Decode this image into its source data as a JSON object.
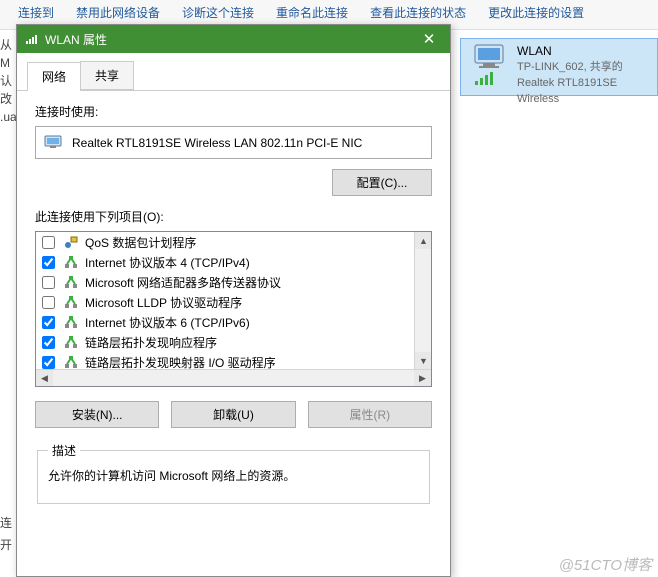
{
  "toolbar": {
    "items": [
      "连接到",
      "禁用此网络设备",
      "诊断这个连接",
      "重命名此连接",
      "查看此连接的状态",
      "更改此连接的设置"
    ]
  },
  "left_strip": "从 M 认 改 .ua",
  "adapter_card": {
    "title": "WLAN",
    "line2": "TP-LINK_602, 共享的",
    "line3": "Realtek RTL8191SE Wireless"
  },
  "dialog": {
    "title": "WLAN 属性",
    "tabs": {
      "t1": "网络",
      "t2": "共享"
    },
    "connect_using_label": "连接时使用:",
    "adapter_name": "Realtek RTL8191SE Wireless LAN 802.11n PCI-E NIC",
    "configure_btn": "配置(C)...",
    "items_label": "此连接使用下列项目(O):",
    "items": [
      {
        "checked": false,
        "icon": "qos",
        "label": "QoS 数据包计划程序"
      },
      {
        "checked": true,
        "icon": "proto",
        "label": "Internet 协议版本 4 (TCP/IPv4)"
      },
      {
        "checked": false,
        "icon": "proto",
        "label": "Microsoft 网络适配器多路传送器协议"
      },
      {
        "checked": false,
        "icon": "proto",
        "label": "Microsoft LLDP 协议驱动程序"
      },
      {
        "checked": true,
        "icon": "proto",
        "label": "Internet 协议版本 6 (TCP/IPv6)"
      },
      {
        "checked": true,
        "icon": "proto",
        "label": "链路层拓扑发现响应程序"
      },
      {
        "checked": true,
        "icon": "proto",
        "label": "链路层拓扑发现映射器 I/O 驱动程序"
      }
    ],
    "install_btn": "安装(N)...",
    "uninstall_btn": "卸载(U)",
    "properties_btn": "属性(R)",
    "desc_legend": "描述",
    "desc_text": "允许你的计算机访问 Microsoft 网络上的资源。"
  },
  "watermark": "@51CTO博客",
  "left_tail": "连 开"
}
